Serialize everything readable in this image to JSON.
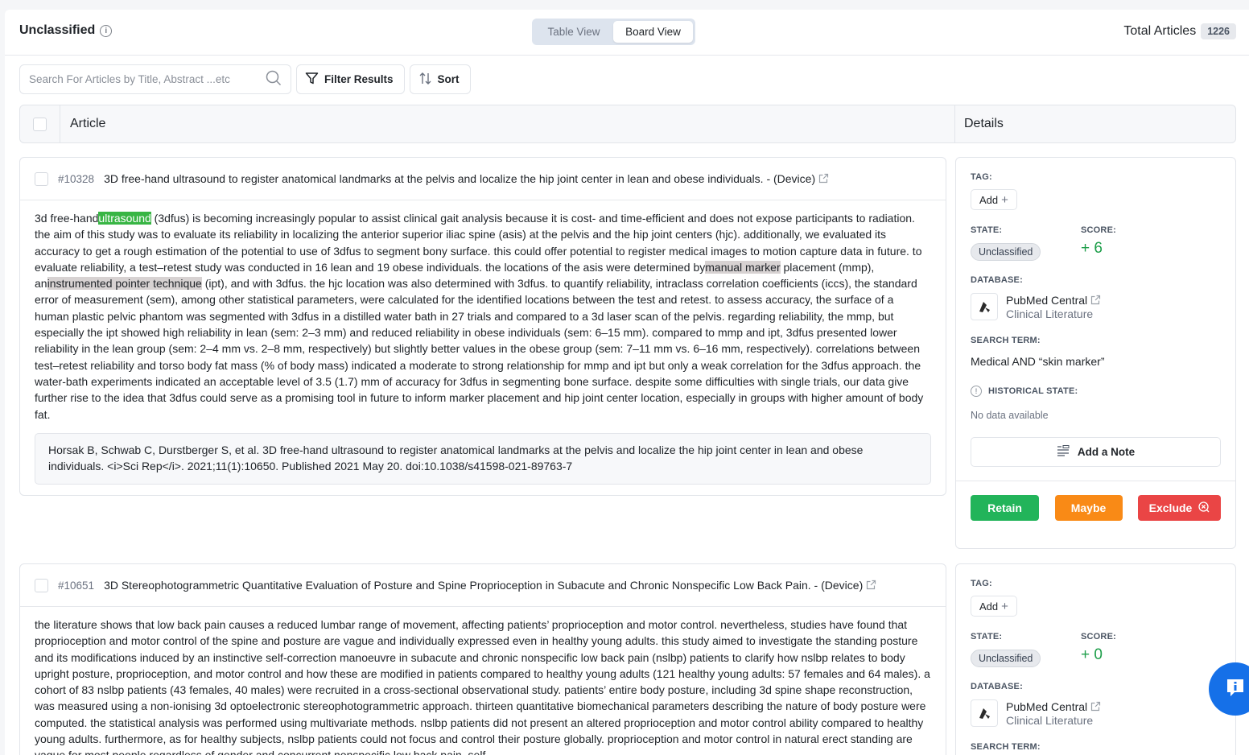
{
  "header": {
    "title": "Unclassified",
    "views": [
      "Table View",
      "Board View"
    ],
    "active_view": "Board View",
    "total_label": "Total Articles",
    "total_count": "1226"
  },
  "toolbar": {
    "search_placeholder": "Search For Articles by Title, Abstract ...etc",
    "filter_label": "Filter Results",
    "sort_label": "Sort"
  },
  "columns": {
    "article": "Article",
    "details": "Details"
  },
  "articles": [
    {
      "id": "#10328",
      "title": "3D free-hand ultrasound to register anatomical landmarks at the pelvis and localize the hip joint center in lean and obese individuals. - (Device)",
      "abstract": {
        "p1": "3d free-hand",
        "hl1": "ultrasound",
        "p2": " (3dfus) is becoming increasingly popular to assist clinical gait analysis because it is cost- and time-efficient and does not expose participants to radiation. the aim of this study was to evaluate its reliability in localizing the anterior superior iliac spine (asis) at the pelvis and the hip joint centers (hjc). additionally, we evaluated its accuracy to get a rough estimation of the potential to use of 3dfus to segment bony surface. this could offer potential to register medical images to motion capture data in future. to evaluate reliability, a test–retest study was conducted in 16 lean and 19 obese individuals. the locations of the asis were determined by",
        "hl2": "manual marker",
        "p3": " placement (mmp), an",
        "hl3": "instrumented pointer technique",
        "p4": " (ipt), and with 3dfus. the hjc location was also determined with 3dfus. to quantify reliability, intraclass correlation coefficients (iccs), the standard error of measurement (sem), among other statistical parameters, were calculated for the identified locations between the test and retest. to assess accuracy, the surface of a human plastic pelvic phantom was segmented with 3dfus in a distilled water bath in 27 trials and compared to a 3d laser scan of the pelvis. regarding reliability, the mmp, but especially the ipt showed high reliability in lean (sem: 2–3 mm) and reduced reliability in obese individuals (sem: 6–15 mm). compared to mmp and ipt, 3dfus presented lower reliability in the lean group (sem: 2–4 mm vs. 2–8 mm, respectively) but slightly better values in the obese group (sem: 7–11 mm vs. 6–16 mm, respectively). correlations between test–retest reliability and torso body fat mass (% of body mass) indicated a moderate to strong relationship for mmp and ipt but only a weak correlation for the 3dfus approach. the water-bath experiments indicated an acceptable level of 3.5 (1.7) mm of accuracy for 3dfus in segmenting bone surface. despite some difficulties with single trials, our data give further rise to the idea that 3dfus could serve as a promising tool in future to inform marker placement and hip joint center location, especially in groups with higher amount of body fat."
      },
      "citation": "Horsak B, Schwab C, Durstberger S, et al. 3D free-hand ultrasound to register anatomical landmarks at the pelvis and localize the hip joint center in lean and obese individuals. <i>Sci Rep</i>. 2021;11(1):10650. Published 2021 May 20. doi:10.1038/s41598-021-89763-7",
      "details": {
        "tag_label": "TAG:",
        "add_label": "Add",
        "state_label": "STATE:",
        "state": "Unclassified",
        "score_label": "SCORE:",
        "score": "+ 6",
        "database_label": "DATABASE:",
        "db_name": "PubMed Central",
        "db_sub": "Clinical Literature",
        "search_term_label": "SEARCH TERM:",
        "search_term": "Medical AND “skin marker”",
        "historical_label": "HISTORICAL STATE:",
        "historical_value": "No data available",
        "note_label": "Add a Note",
        "retain": "Retain",
        "maybe": "Maybe",
        "exclude": "Exclude"
      }
    },
    {
      "id": "#10651",
      "title": "3D Stereophotogrammetric Quantitative Evaluation of Posture and Spine Proprioception in Subacute and Chronic Nonspecific Low Back Pain. - (Device)",
      "abstract_text": "the literature shows that low back pain causes a reduced lumbar range of movement, affecting patients’ proprioception and motor control. nevertheless, studies have found that proprioception and motor control of the spine and posture are vague and individually expressed even in healthy young adults. this study aimed to investigate the standing posture and its modifications induced by an instinctive self-correction manoeuvre in subacute and chronic nonspecific low back pain (nslbp) patients to clarify how nslbp relates to body upright posture, proprioception, and motor control and how these are modified in patients compared to healthy young adults (121 healthy young adults: 57 females and 64 males). a cohort of 83 nslbp patients (43 females, 40 males) were recruited in a cross-sectional observational study. patients’ entire body posture, including 3d spine shape reconstruction, was measured using a non-ionising 3d optoelectronic stereophotogrammetric approach. thirteen quantitative biomechanical parameters describing the nature of body posture were computed. the statistical analysis was performed using multivariate methods. nslbp patients did not present an altered proprioception and motor control ability compared to healthy young adults. furthermore, as for healthy subjects, nslbp patients could not focus and control their posture globally. proprioception and motor control in natural erect standing are vague for most people regardless of gender and concurrent nonspecific low back pain. self-",
      "details": {
        "tag_label": "TAG:",
        "add_label": "Add",
        "state_label": "STATE:",
        "state": "Unclassified",
        "score_label": "SCORE:",
        "score": "+ 0",
        "database_label": "DATABASE:",
        "db_name": "PubMed Central",
        "db_sub": "Clinical Literature",
        "search_term_label": "SEARCH TERM:"
      }
    }
  ],
  "icons": {
    "info": "info-circle-icon",
    "search": "search-icon",
    "filter": "filter-icon",
    "sort": "sort-icon",
    "external": "external-link-icon",
    "note": "note-icon",
    "chat": "chat-support-icon"
  },
  "colors": {
    "highlight_green": "#38b544",
    "highlight_grey": "#d7d2d2",
    "score_green": "#1e9e4a",
    "retain": "#22b45a",
    "maybe": "#f98a16",
    "exclude": "#ea4545",
    "chat_fab": "#1570e8"
  }
}
